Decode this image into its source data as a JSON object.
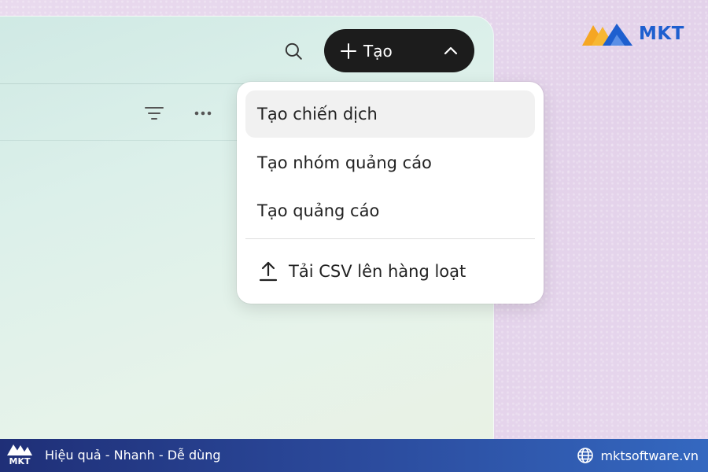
{
  "header": {
    "create_button_label": "Tạo",
    "icons": [
      "search-icon",
      "plus-icon",
      "chevron-up-icon"
    ]
  },
  "toolbar": {
    "icons": [
      "filter-icon",
      "more-icon"
    ]
  },
  "dropdown": {
    "items": [
      {
        "label": "Tạo chiến dịch",
        "active": true
      },
      {
        "label": "Tạo nhóm quảng cáo",
        "active": false
      },
      {
        "label": "Tạo quảng cáo",
        "active": false
      }
    ],
    "upload_item": {
      "label": "Tải CSV lên hàng loạt",
      "icon": "upload-icon"
    }
  },
  "brand": {
    "logo_text": "MKT",
    "logo_colors": [
      "#f5a623",
      "#1e5fcf"
    ]
  },
  "footer": {
    "logo_text": "MKT",
    "slogan": "Hiệu quả - Nhanh - Dễ dùng",
    "website": "mktsoftware.vn",
    "icons": [
      "globe-icon"
    ],
    "background_colors": [
      "#1f2f77",
      "#3468c0"
    ]
  }
}
